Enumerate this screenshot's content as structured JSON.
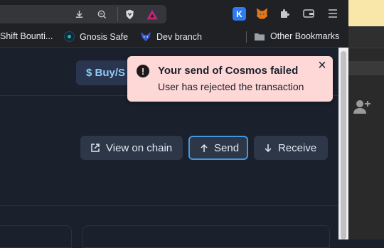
{
  "bookmarks": [
    {
      "label": "Shift Bounti..."
    },
    {
      "label": "Gnosis Safe",
      "icon": "gnosis-icon"
    },
    {
      "label": "Dev branch",
      "icon": "fox-icon"
    },
    {
      "label": "Other Bookmarks",
      "icon": "folder-icon"
    }
  ],
  "buy_button": {
    "label": "$ Buy/S"
  },
  "toast": {
    "title": "Your send of Cosmos failed",
    "message": "User has rejected the transaction",
    "icon": "exclamation-icon",
    "close": "×"
  },
  "actions": {
    "view_on_chain": "View on chain",
    "send": "Send",
    "receive": "Receive"
  },
  "colors": {
    "toast_bg": "#fed7d7",
    "page_bg": "#1a202c",
    "button_bg": "#2d3748",
    "send_border": "#4299e1",
    "accent_blue": "#63b3ed"
  }
}
